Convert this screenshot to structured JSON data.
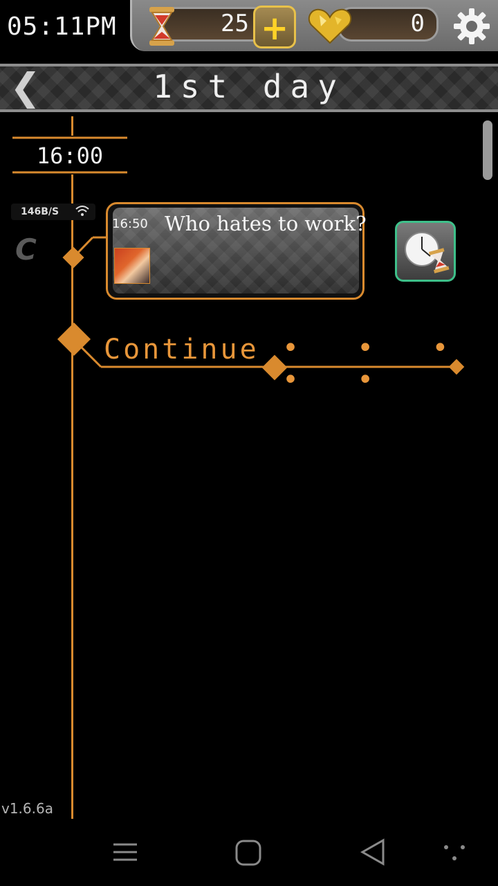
{
  "status_bar": {
    "clock": "05:11PM"
  },
  "currency": {
    "hourglass_count": "25",
    "heart_count": "0"
  },
  "title_bar": {
    "back_label": "❮",
    "title": "1st day"
  },
  "timeline": {
    "time_label": "16:00",
    "network_speed": "146B/S",
    "chat": {
      "time": "16:50",
      "title": "Who hates to work?"
    },
    "continue_label": "Continue",
    "continue_dots": "• • • • •"
  },
  "version": "v1.6.6a",
  "colors": {
    "accent": "#d98a2e",
    "time_travel_border": "#3ec08a"
  }
}
